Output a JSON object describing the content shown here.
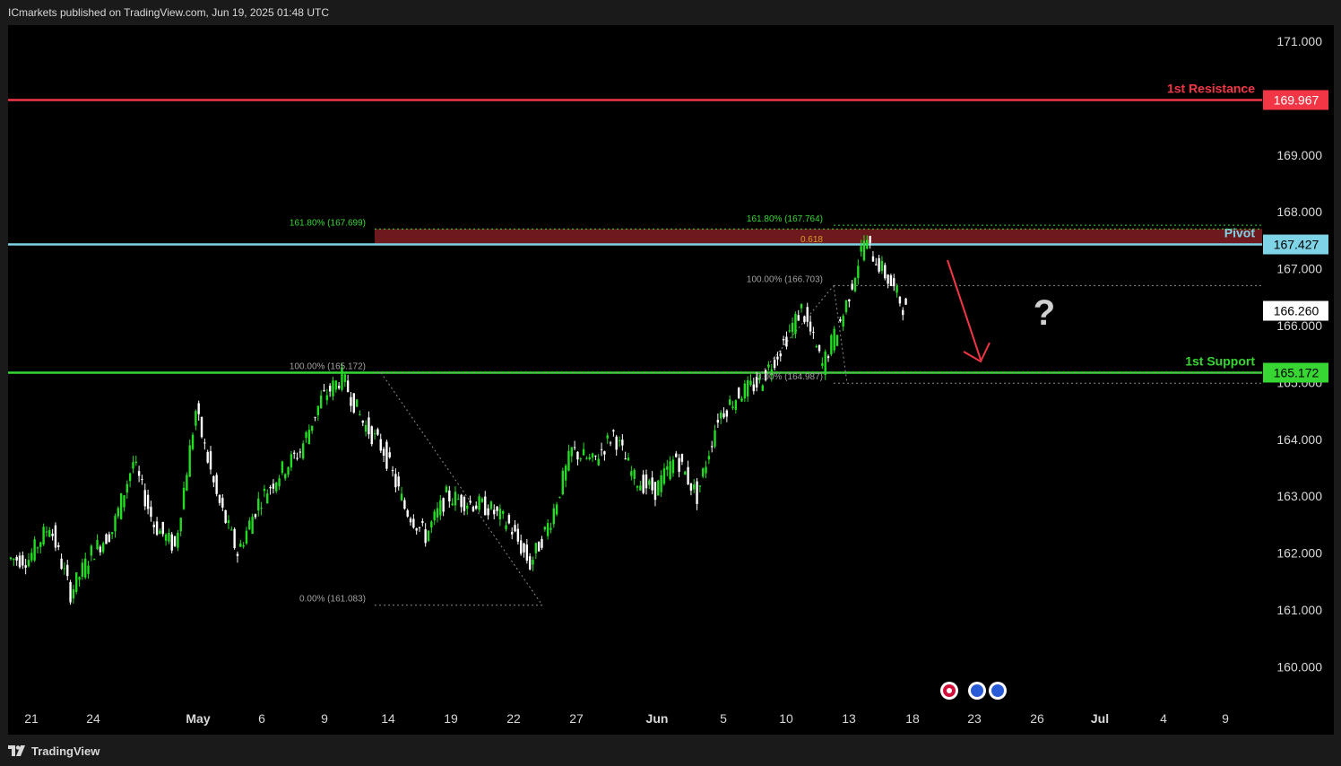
{
  "header": {
    "publisher_text": "ICmarkets published on TradingView.com, Jun 19, 2025 01:48 UTC"
  },
  "footer": {
    "brand": "TradingView"
  },
  "colors": {
    "background": "#000000",
    "frame": "#1a1a1a",
    "bull": "#22dd22",
    "bear": "#ffffff",
    "resistance": "#f23645",
    "pivot": "#7fd3e6",
    "support": "#37d633",
    "fib_zone": "#7a1c20",
    "arrow": "#f23645"
  },
  "chart_data": {
    "type": "candlestick",
    "title": "",
    "ylim": [
      159.55,
      171.36
    ],
    "y_ticks": [
      "171.000",
      "169.000",
      "168.000",
      "167.000",
      "166.000",
      "165.000",
      "164.000",
      "163.000",
      "162.000",
      "161.000",
      "160.000"
    ],
    "x_ticks": [
      "21",
      "24",
      "May",
      "6",
      "9",
      "14",
      "19",
      "22",
      "27",
      "Jun",
      "5",
      "10",
      "13",
      "18",
      "23",
      "26",
      "Jul",
      "4",
      "9"
    ],
    "x_tick_bold": [
      "May",
      "Jun",
      "Jul"
    ],
    "last_price": "166.260",
    "levels": [
      {
        "name": "1st Resistance",
        "price": 169.967,
        "label": "169.967"
      },
      {
        "name": "Pivot",
        "price": 167.427,
        "label": "167.427"
      },
      {
        "name": "1st Support",
        "price": 165.172,
        "label": "165.172"
      }
    ],
    "fib_labels": [
      {
        "text": "161.80% (167.699)",
        "price": 167.699
      },
      {
        "text": "161.80% (167.764)",
        "price": 167.764
      },
      {
        "text": "0.618",
        "price": 167.4
      },
      {
        "text": "100.00% (166.703)",
        "price": 166.703
      },
      {
        "text": "100.00% (165.172)",
        "price": 165.172
      },
      {
        "text": "0.00% (164.987)",
        "price": 164.987
      },
      {
        "text": "0.00% (161.083)",
        "price": 161.083
      }
    ],
    "annotation": "?",
    "series": [
      {
        "date": "Apr 21",
        "close": 161.9
      },
      {
        "date": "Apr 22",
        "close": 162.5
      },
      {
        "date": "Apr 23",
        "close": 161.3
      },
      {
        "date": "Apr 24",
        "close": 162.0
      },
      {
        "date": "Apr 25",
        "close": 162.4
      },
      {
        "date": "Apr 28",
        "close": 163.6
      },
      {
        "date": "Apr 29",
        "close": 162.5
      },
      {
        "date": "Apr 30",
        "close": 162.1
      },
      {
        "date": "May 1",
        "close": 164.5
      },
      {
        "date": "May 2",
        "close": 163.0
      },
      {
        "date": "May 5",
        "close": 162.0
      },
      {
        "date": "May 6",
        "close": 162.9
      },
      {
        "date": "May 7",
        "close": 163.4
      },
      {
        "date": "May 8",
        "close": 163.8
      },
      {
        "date": "May 9",
        "close": 164.7
      },
      {
        "date": "May 12",
        "close": 165.1
      },
      {
        "date": "May 13",
        "close": 164.3
      },
      {
        "date": "May 14",
        "close": 163.8
      },
      {
        "date": "May 15",
        "close": 162.8
      },
      {
        "date": "May 16",
        "close": 162.3
      },
      {
        "date": "May 19",
        "close": 163.0
      },
      {
        "date": "May 20",
        "close": 162.9
      },
      {
        "date": "May 21",
        "close": 162.8
      },
      {
        "date": "May 22",
        "close": 162.5
      },
      {
        "date": "May 23",
        "close": 161.8
      },
      {
        "date": "May 26",
        "close": 162.6
      },
      {
        "date": "May 27",
        "close": 163.8
      },
      {
        "date": "May 28",
        "close": 163.6
      },
      {
        "date": "May 29",
        "close": 164.1
      },
      {
        "date": "May 30",
        "close": 163.3
      },
      {
        "date": "Jun 2",
        "close": 163.1
      },
      {
        "date": "Jun 3",
        "close": 163.7
      },
      {
        "date": "Jun 4",
        "close": 163.0
      },
      {
        "date": "Jun 5",
        "close": 164.4
      },
      {
        "date": "Jun 6",
        "close": 164.8
      },
      {
        "date": "Jun 9",
        "close": 165.0
      },
      {
        "date": "Jun 10",
        "close": 165.6
      },
      {
        "date": "Jun 11",
        "close": 166.3
      },
      {
        "date": "Jun 12",
        "close": 165.3
      },
      {
        "date": "Jun 13",
        "close": 166.2
      },
      {
        "date": "Jun 16",
        "close": 167.5
      },
      {
        "date": "Jun 17",
        "close": 166.9
      },
      {
        "date": "Jun 18",
        "close": 166.26
      }
    ]
  }
}
